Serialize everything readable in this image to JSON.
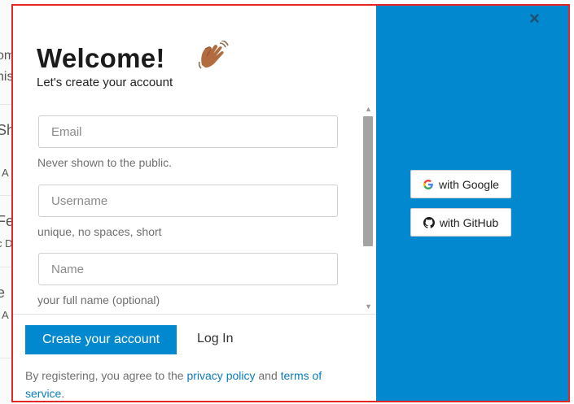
{
  "background_fragments": [
    "om",
    "nis",
    "Sh",
    "A",
    "Fe",
    "c D",
    "e",
    "A"
  ],
  "modal": {
    "close_label": "×",
    "welcome_title": "Welcome!",
    "subtitle": "Let's create your account",
    "fields": [
      {
        "placeholder": "Email",
        "value": "",
        "hint": "Never shown to the public."
      },
      {
        "placeholder": "Username",
        "value": "",
        "hint": "unique, no spaces, short"
      },
      {
        "placeholder": "Name",
        "value": "",
        "hint": "your full name (optional)"
      }
    ],
    "create_button": "Create your account",
    "login_button": "Log In",
    "legal": {
      "prefix": "By registering, you agree to the",
      "privacy_link": "privacy policy",
      "and": "and",
      "terms_link": "terms of service",
      "suffix": "."
    },
    "social": [
      {
        "label": "with Google",
        "icon": "google-icon"
      },
      {
        "label": "with GitHub",
        "icon": "github-icon"
      }
    ]
  },
  "colors": {
    "accent": "#0288cf",
    "link": "#0a7cc0",
    "border_highlight": "#e32626"
  }
}
